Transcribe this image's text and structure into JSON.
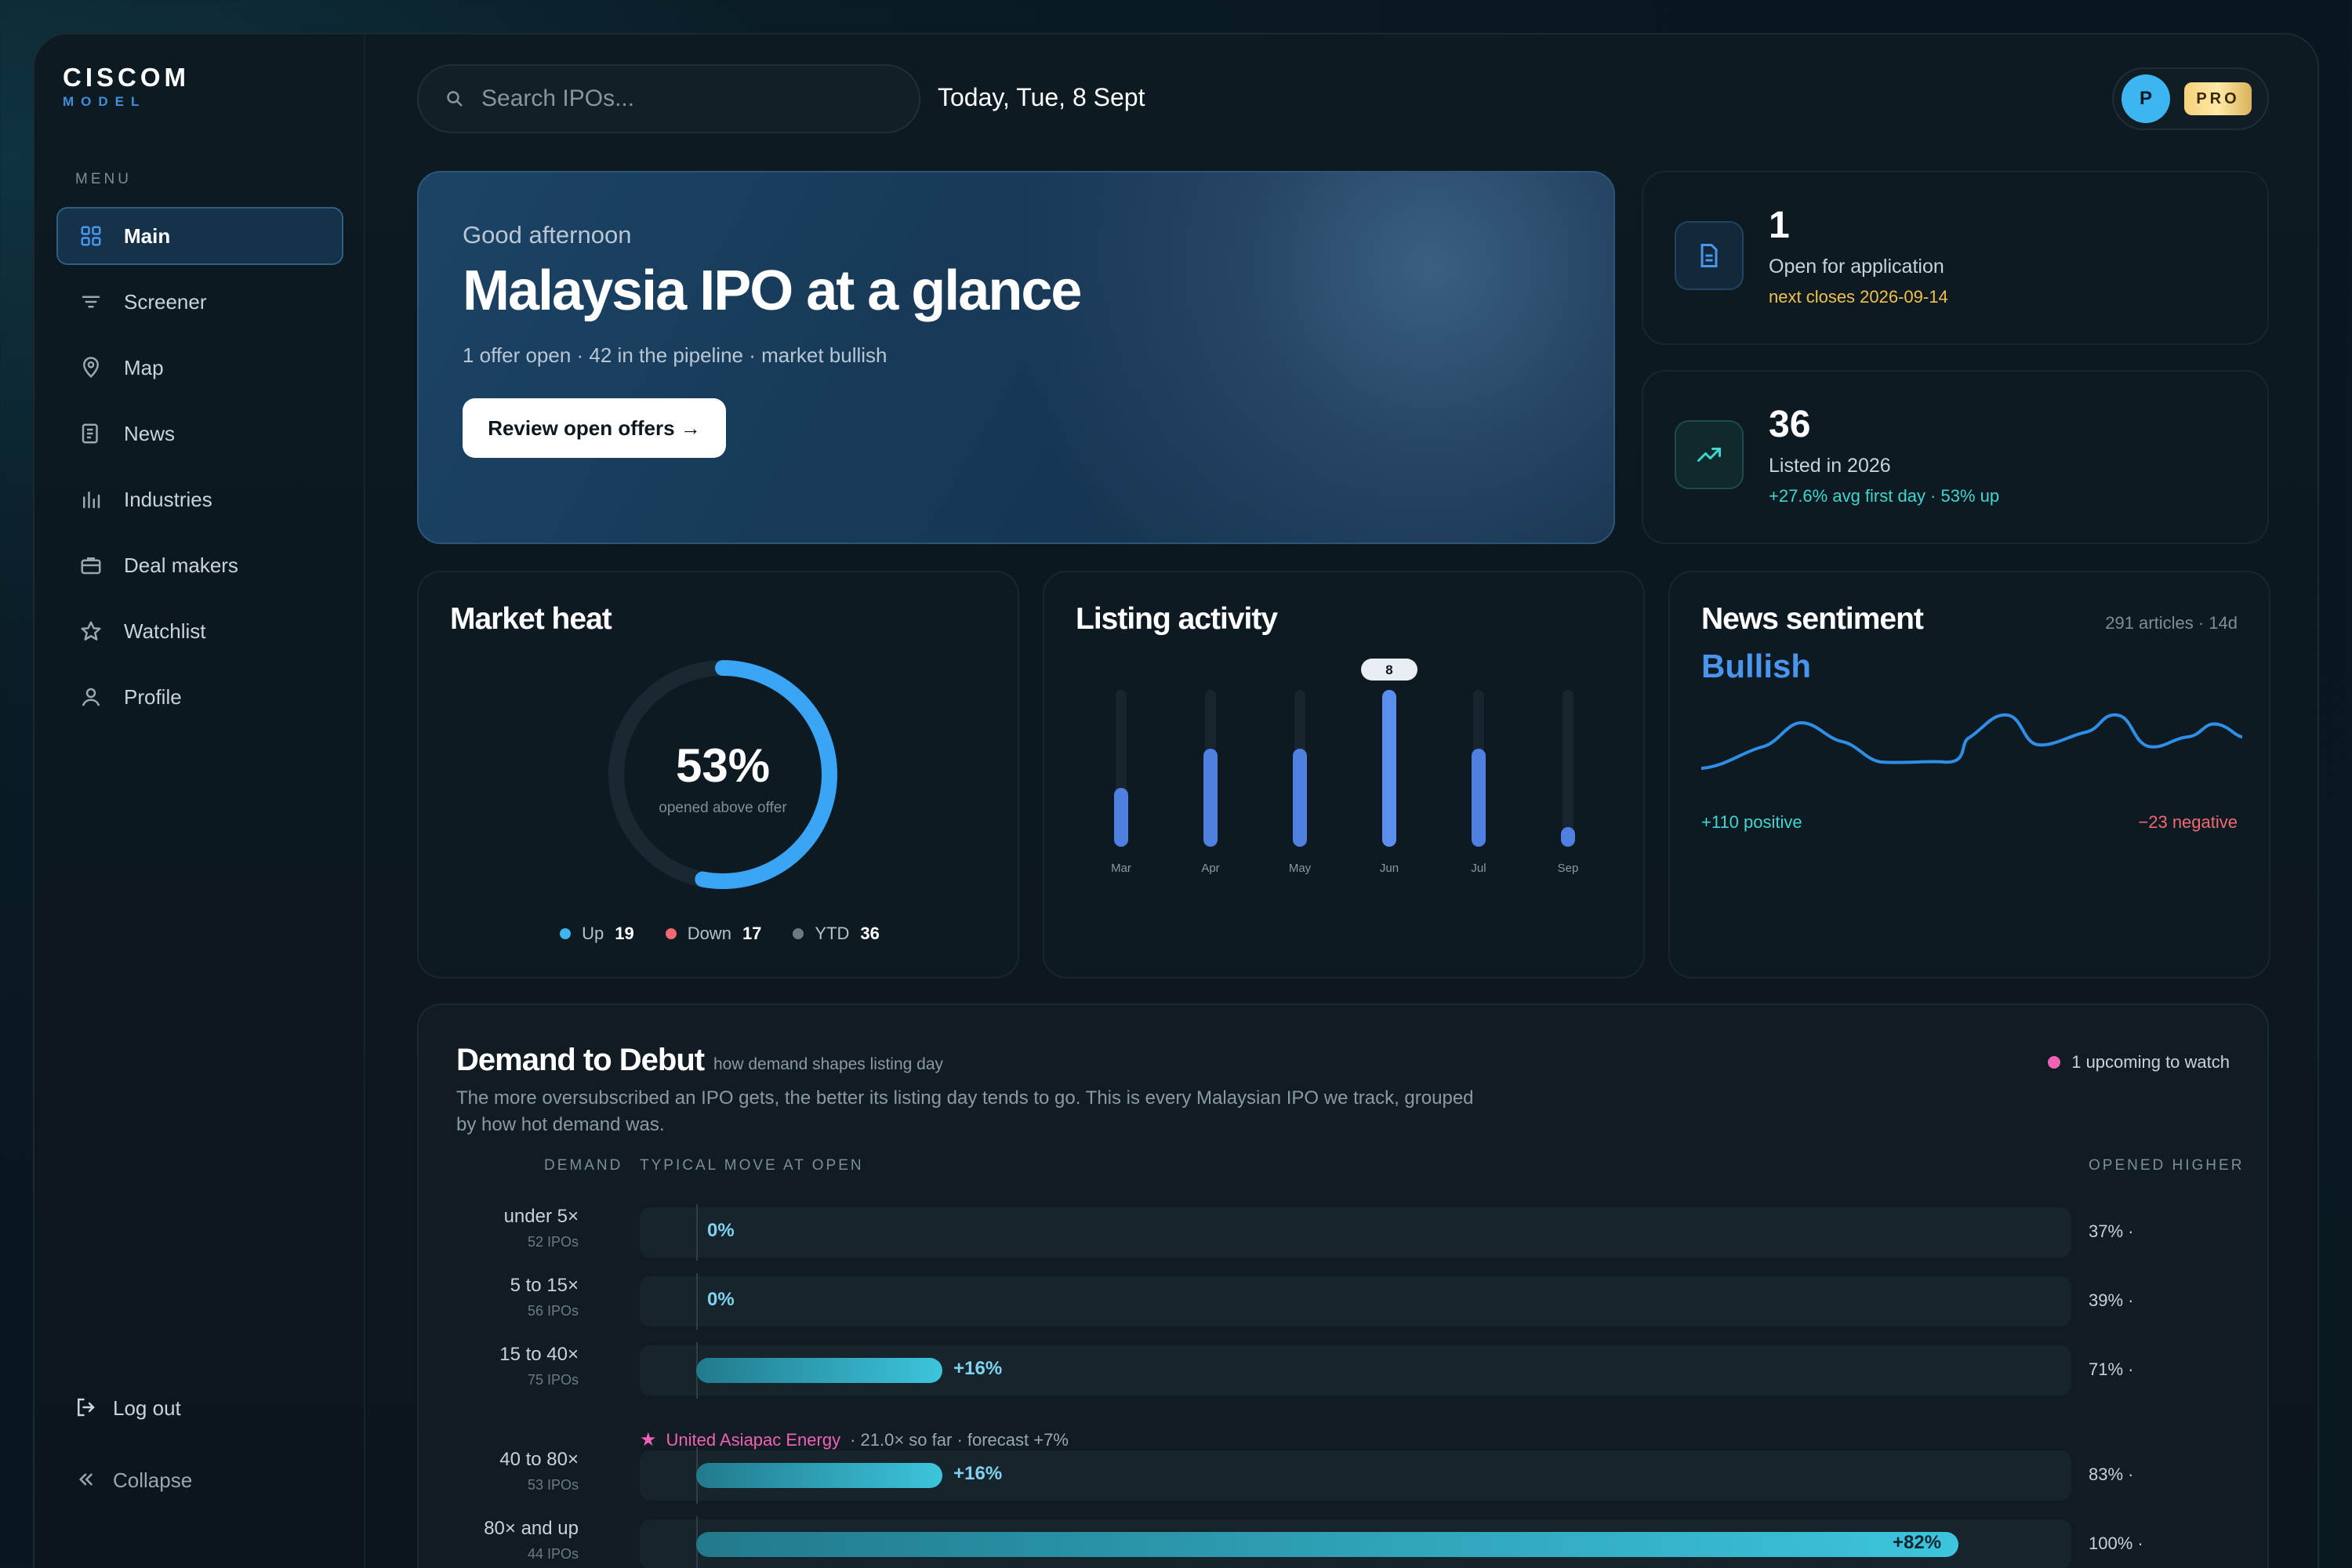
{
  "brand": {
    "name": "CISCOM",
    "sub": "MODEL"
  },
  "sidebar": {
    "menu_label": "MENU",
    "items": [
      {
        "label": "Main",
        "icon": "grid-icon"
      },
      {
        "label": "Screener",
        "icon": "filter-icon"
      },
      {
        "label": "Map",
        "icon": "map-pin-icon"
      },
      {
        "label": "News",
        "icon": "newspaper-icon"
      },
      {
        "label": "Industries",
        "icon": "bar-chart-icon"
      },
      {
        "label": "Deal makers",
        "icon": "briefcase-icon"
      },
      {
        "label": "Watchlist",
        "icon": "star-icon"
      },
      {
        "label": "Profile",
        "icon": "user-icon"
      }
    ],
    "logout": "Log out",
    "collapse": "Collapse"
  },
  "topbar": {
    "search_placeholder": "Search IPOs...",
    "date": "Today, Tue, 8 Sept",
    "avatar_initial": "P",
    "badge": "PRO"
  },
  "hero": {
    "greeting": "Good afternoon",
    "title": "Malaysia IPO at a glance",
    "subtitle": "1 offer open · 42 in the pipeline · market bullish",
    "button": "Review open offers →"
  },
  "stats": [
    {
      "value": "1",
      "label": "Open for application",
      "note": "next closes 2026-09-14",
      "icon": "document-icon"
    },
    {
      "value": "36",
      "label": "Listed in 2026",
      "note": "+27.6% avg first day · 53% up",
      "icon": "trending-up-icon"
    }
  ],
  "market_heat": {
    "title": "Market heat",
    "value_label": "53%",
    "value": 0.53,
    "caption": "opened above offer",
    "legend": [
      {
        "label": "Up",
        "value": "19",
        "color": "#3cb5f0"
      },
      {
        "label": "Down",
        "value": "17",
        "color": "#ef6a73"
      },
      {
        "label": "YTD",
        "value": "36",
        "color": "#6d7a84"
      }
    ]
  },
  "listing_activity": {
    "title": "Listing activity",
    "highlight_label": "8"
  },
  "chart_data": {
    "type": "bar",
    "categories": [
      "Mar",
      "Apr",
      "May",
      "Jun",
      "Jul",
      "Sep"
    ],
    "values": [
      3,
      5,
      5,
      8,
      5,
      1
    ],
    "ylim": [
      0,
      8
    ],
    "annotation": {
      "category": "Jun",
      "label": "8"
    }
  },
  "news_sentiment": {
    "title": "News sentiment",
    "meta": "291 articles · 14d",
    "verdict": "Bullish",
    "positive": "+110 positive",
    "negative": "−23 negative"
  },
  "demand": {
    "title": "Demand to Debut",
    "tag": "how demand shapes listing day",
    "description": "The more oversubscribed an IPO gets, the better its listing day tends to go. This is every Malaysian IPO we track, grouped by how hot demand was.",
    "watch": "1 upcoming to watch",
    "headers": {
      "demand": "DEMAND",
      "move": "TYPICAL MOVE AT OPEN",
      "higher": "OPENED HIGHER"
    },
    "rows": [
      {
        "label": "under 5×",
        "count": "52 IPOs",
        "move": "0%",
        "move_value": 0,
        "higher": "37% ·"
      },
      {
        "label": "5 to 15×",
        "count": "56 IPOs",
        "move": "0%",
        "move_value": 0,
        "higher": "39% ·"
      },
      {
        "label": "15 to 40×",
        "count": "75 IPOs",
        "move": "+16%",
        "move_value": 16,
        "higher": "71% ·"
      },
      {
        "label": "40 to 80×",
        "count": "53 IPOs",
        "move": "+16%",
        "move_value": 16,
        "higher": "83% ·"
      },
      {
        "label": "80× and up",
        "count": "44 IPOs",
        "move": "+82%",
        "move_value": 82,
        "higher": "100% ·"
      }
    ],
    "callout": {
      "name": "United Asiapac Energy",
      "detail": "· 21.0× so far · forecast +7%"
    }
  }
}
